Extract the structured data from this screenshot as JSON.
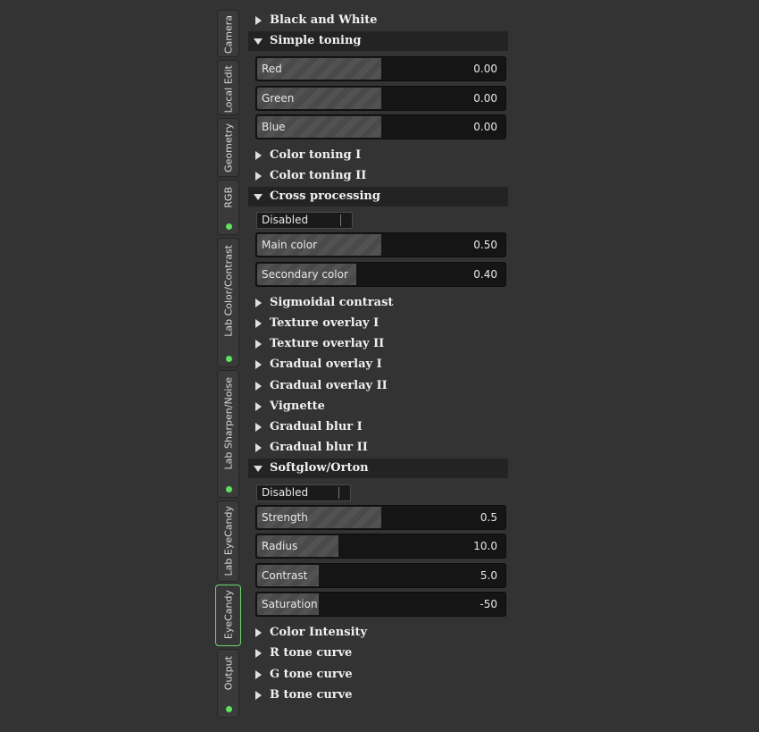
{
  "tabs": [
    {
      "label": "Camera",
      "dot": false,
      "active": false
    },
    {
      "label": "Local Edit",
      "dot": false,
      "active": false
    },
    {
      "label": "Geometry",
      "dot": false,
      "active": false
    },
    {
      "label": "RGB",
      "dot": true,
      "active": false
    },
    {
      "label": "Lab Color/Contrast",
      "dot": true,
      "active": false
    },
    {
      "label": "Lab Sharpen/Noise",
      "dot": true,
      "active": false
    },
    {
      "label": "Lab EyeCandy",
      "dot": false,
      "active": false
    },
    {
      "label": "EyeCandy",
      "dot": false,
      "active": true
    },
    {
      "label": "Output",
      "dot": true,
      "active": false
    }
  ],
  "sections": {
    "black_and_white": "Black and White",
    "simple_toning": "Simple toning",
    "color_toning_1": "Color toning I",
    "color_toning_2": "Color toning II",
    "cross_processing": "Cross processing",
    "sigmoidal_contrast": "Sigmoidal contrast",
    "texture_overlay_1": "Texture overlay I",
    "texture_overlay_2": "Texture overlay II",
    "gradual_overlay_1": "Gradual overlay I",
    "gradual_overlay_2": "Gradual overlay II",
    "vignette": "Vignette",
    "gradual_blur_1": "Gradual blur I",
    "gradual_blur_2": "Gradual blur II",
    "softglow_orton": "Softglow/Orton",
    "color_intensity": "Color Intensity",
    "r_tone_curve": "R tone curve",
    "g_tone_curve": "G tone curve",
    "b_tone_curve": "B tone curve"
  },
  "simple_toning": {
    "red": {
      "label": "Red",
      "value": "0.00",
      "fill": 0.5
    },
    "green": {
      "label": "Green",
      "value": "0.00",
      "fill": 0.5
    },
    "blue": {
      "label": "Blue",
      "value": "0.00",
      "fill": 0.5
    }
  },
  "cross_processing": {
    "mode": "Disabled",
    "main_color": {
      "label": "Main color",
      "value": "0.50",
      "fill": 0.5
    },
    "secondary_color": {
      "label": "Secondary color",
      "value": "0.40",
      "fill": 0.4
    }
  },
  "softglow_orton": {
    "mode": "Disabled",
    "strength": {
      "label": "Strength",
      "value": "0.5",
      "fill": 0.5
    },
    "radius": {
      "label": "Radius",
      "value": "10.0",
      "fill": 0.33
    },
    "contrast": {
      "label": "Contrast",
      "value": "5.0",
      "fill": 0.25
    },
    "saturation": {
      "label": "Saturation",
      "value": "-50",
      "fill": 0.25
    }
  },
  "colors": {
    "background": "#333333",
    "active_tab_border": "#6ed46e",
    "status_dot": "#5fe05f",
    "open_section_bg": "#232323"
  }
}
